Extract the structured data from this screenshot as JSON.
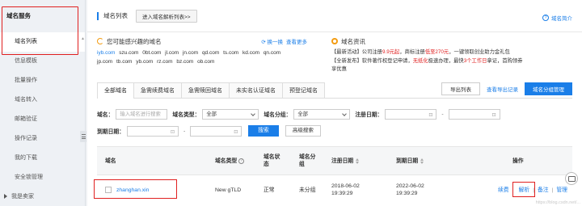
{
  "sidebar": {
    "header": "域名服务",
    "items": [
      {
        "label": "域名列表",
        "active": true
      },
      {
        "label": "信息模板"
      },
      {
        "label": "批量操作"
      },
      {
        "label": "域名转入"
      },
      {
        "label": "邮箱验证"
      },
      {
        "label": "操作记录"
      },
      {
        "label": "我的下载"
      },
      {
        "label": "安全锁管理"
      },
      {
        "label": "我是卖家"
      }
    ]
  },
  "topbar": {
    "title": "域名列表",
    "import_button": "进入域名解析列表>>",
    "help_link": "域名简介"
  },
  "suggest": {
    "title": "您可能感兴趣的域名",
    "refresh": "换一换",
    "more": "查看更多",
    "line1": [
      "iyb.com",
      "szu.com",
      "0bt.com",
      "jl.com",
      "jn.com",
      "qd.com",
      "ts.com",
      "kd.com",
      "qn.com"
    ],
    "line2": [
      "jp.com",
      "tb.com",
      "yb.com",
      "rz.com",
      "bz.com",
      "ob.com"
    ]
  },
  "news": {
    "title": "域名资讯",
    "item1_a": "【最新活动】公司注册",
    "item1_red1": "9.9元起",
    "item1_b": "，商标注册",
    "item1_red2": "低至270元",
    "item1_c": "，一键领取创业助力金礼包",
    "item2_a": "【全新发布】软件著作权登记申请，",
    "item2_red1": "无纸化",
    "item2_b": "极速办理，最快",
    "item2_red2": "3个工作日",
    "item2_c": "拿证，首购领券",
    "item2_d": "享优惠"
  },
  "tabs": [
    "全部域名",
    "急需续费域名",
    "急需赎回域名",
    "未实名认证域名",
    "预登记域名"
  ],
  "actions": {
    "export": "导出列表",
    "export_records": "查看导出记录",
    "group_manage": "域名分组管理"
  },
  "filters": {
    "domain_label": "域名：",
    "domain_placeholder": "输入域名进行搜索",
    "type_label": "域名类型：",
    "type_value": "全部",
    "group_label": "域名分组：",
    "group_value": "全部",
    "reg_date_label": "注册日期：",
    "exp_date_label": "到期日期：",
    "dash": "-",
    "search_button": "搜索",
    "advanced_button": "高级搜索"
  },
  "table": {
    "headers": {
      "domain": "域名",
      "type": "域名类型",
      "status": "域名状态",
      "group": "域名分组",
      "reg_date": "注册日期",
      "exp_date": "到期日期",
      "ops": "操作"
    },
    "rows": [
      {
        "domain": "zhanghan.xin",
        "type": "New gTLD",
        "status": "正常",
        "group": "未分组",
        "reg_date": "2018-06-02",
        "reg_time": "19:39:29",
        "exp_date": "2022-06-02",
        "exp_time": "19:39:29",
        "ops": [
          "续费",
          "解析",
          "备注",
          "管理"
        ]
      }
    ]
  },
  "watermark": "https://blog.csdn.net/..."
}
